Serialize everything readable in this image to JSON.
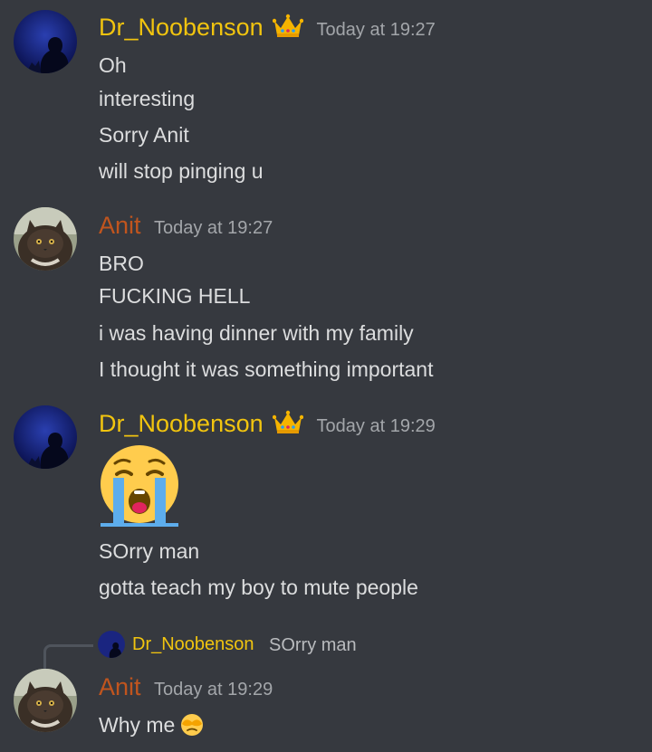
{
  "messages": [
    {
      "author": "Dr_Noobenson",
      "timestamp": "Today at 19:27",
      "badge": "crown-icon",
      "lines": [
        "Oh",
        "interesting",
        "Sorry Anit",
        "will stop pinging u"
      ]
    },
    {
      "author": "Anit",
      "timestamp": "Today at 19:27",
      "lines": [
        "BRO",
        "FUCKING HELL",
        "i was having dinner with my family",
        "I thought it was something important"
      ]
    },
    {
      "author": "Dr_Noobenson",
      "timestamp": "Today at 19:29",
      "badge": "crown-icon",
      "emoji": "loudly-crying-face-icon",
      "lines": [
        "SOrry man",
        "gotta teach my boy to mute people"
      ]
    },
    {
      "author": "Anit",
      "timestamp": "Today at 19:29",
      "reply_to": {
        "author": "Dr_Noobenson",
        "text": "SOrry man"
      },
      "lines": [
        "Why me"
      ],
      "inline_emoji": "face-covering-eyes-icon"
    }
  ],
  "colors": {
    "background": "#36393f",
    "dr_noobenson": "#f1c40f",
    "anit": "#c1551e",
    "text": "#dcddde",
    "timestamp": "#a3a6aa"
  }
}
